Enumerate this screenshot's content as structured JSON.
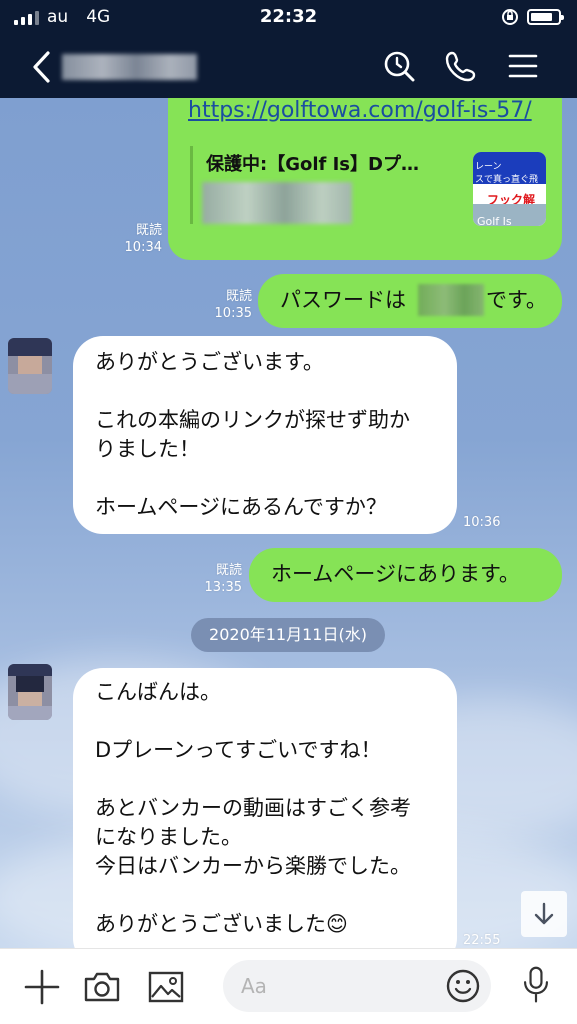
{
  "status_bar": {
    "carrier": "au",
    "network": "4G",
    "time": "22:32",
    "battery_level": 0.8
  },
  "header": {
    "contact_name_redacted": true,
    "icons": [
      "chevron-left-icon",
      "search-icon",
      "phone-icon",
      "menu-icon"
    ]
  },
  "messages": {
    "link_message": {
      "url": "https://golftowa.com/golf-is-57/",
      "preview_title": "保護中:【Golf Is】Dプ…",
      "thumb_line1": "レーン",
      "thumb_line2": "スで真っ直ぐ飛",
      "thumb_line3": "フック解",
      "thumb_line4": "Golf Is",
      "read_label": "既読",
      "time": "10:34"
    },
    "password_message": {
      "text_before": "パスワードは",
      "text_after": "です。",
      "read_label": "既読",
      "time": "10:35"
    },
    "reply_1": {
      "lines": [
        "ありがとうございます。",
        "",
        "これの本編のリンクが探せず助か",
        "りました！",
        "",
        "ホームページにあるんですか？"
      ],
      "time": "10:36"
    },
    "sent_2": {
      "text": "ホームページにあります。",
      "read_label": "既読",
      "time": "13:35"
    },
    "date_separator": "2020年11月11日(水)",
    "reply_2": {
      "lines": [
        "こんばんは。",
        "",
        "Dプレーンってすごいですね！",
        "",
        "あとバンカーの動画はすごく参考",
        "になりました。",
        "今日はバンカーから楽勝でした。",
        "",
        "ありがとうございました"
      ],
      "emoji": "😊",
      "time": "22:55"
    }
  },
  "input_bar": {
    "placeholder": "Aa",
    "icons": [
      "plus-icon",
      "camera-icon",
      "image-icon",
      "emoji-icon",
      "microphone-icon"
    ]
  },
  "colors": {
    "header_bg": "#0c1a33",
    "sent_bubble": "#86e356",
    "received_bubble": "#ffffff",
    "chat_bg": "#86a5d3"
  }
}
